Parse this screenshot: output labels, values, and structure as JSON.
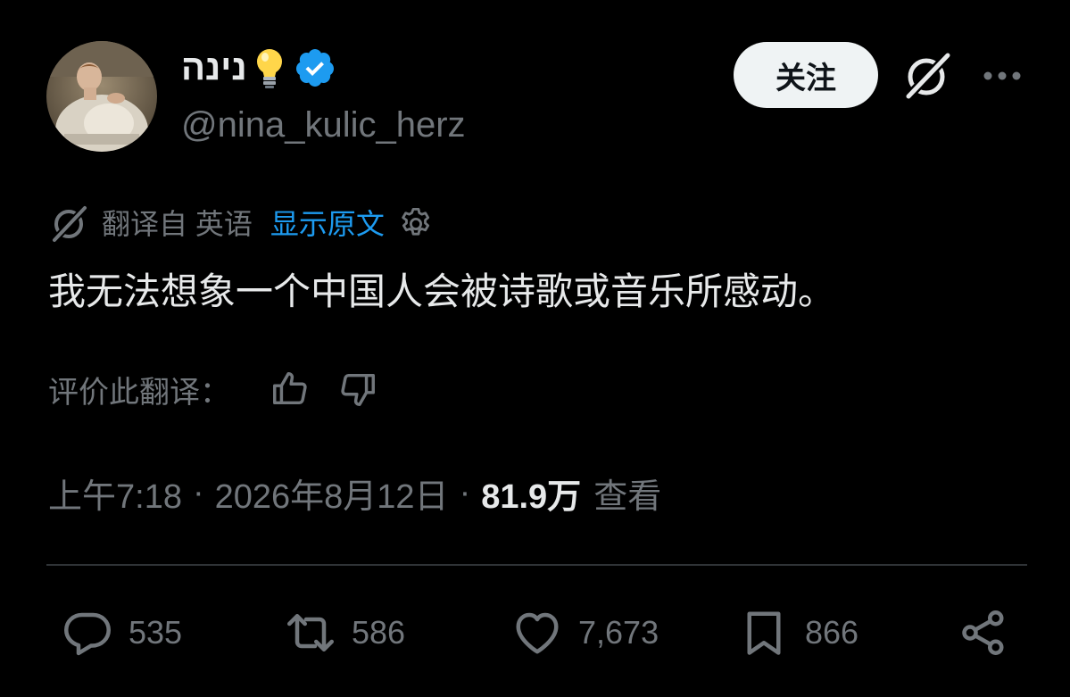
{
  "header": {
    "display_name": "נינה",
    "handle": "@nina_kulic_herz",
    "follow_label": "关注",
    "verified_color": "#1d9bf0"
  },
  "translation": {
    "from_label": "翻译自 英语",
    "show_original_label": "显示原文"
  },
  "tweet": {
    "text": "我无法想象一个中国人会被诗歌或音乐所感动。"
  },
  "rating": {
    "label": "评价此翻译："
  },
  "meta": {
    "time": "上午7:18",
    "separator": "·",
    "date": "2026年8月12日",
    "views_count": "81.9万",
    "views_label": "查看"
  },
  "actions": {
    "replies": "535",
    "retweets": "586",
    "likes": "7,673",
    "bookmarks": "866"
  },
  "colors": {
    "background": "#000000",
    "text_primary": "#e7e9ea",
    "text_secondary": "#71767b",
    "link": "#1d9bf0",
    "divider": "#2f3336"
  },
  "icons": [
    "avatar",
    "lightbulb-icon",
    "verified-badge-icon",
    "grok-icon",
    "more-icon",
    "gear-icon",
    "thumbs-up-icon",
    "thumbs-down-icon",
    "reply-icon",
    "retweet-icon",
    "like-icon",
    "bookmark-icon",
    "share-icon"
  ]
}
